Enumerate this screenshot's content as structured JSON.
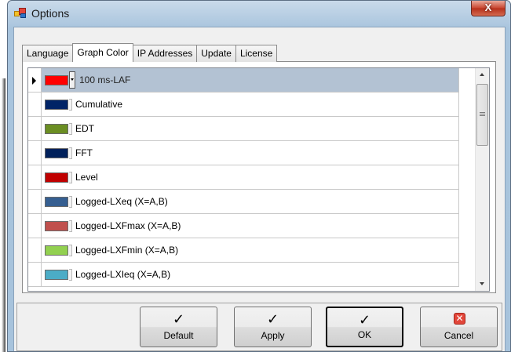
{
  "window": {
    "title": "Options",
    "close_glyph": "X"
  },
  "tabs": [
    {
      "label": "Language",
      "active": false
    },
    {
      "label": "Graph Color",
      "active": true
    },
    {
      "label": "IP Addresses",
      "active": false
    },
    {
      "label": "Update",
      "active": false
    },
    {
      "label": "License",
      "active": false
    }
  ],
  "grid": {
    "rows": [
      {
        "label": "100 ms-LAF",
        "color": "#ff0000",
        "selected": true
      },
      {
        "label": "Cumulative",
        "color": "#002366",
        "selected": false
      },
      {
        "label": "EDT",
        "color": "#6b8e23",
        "selected": false
      },
      {
        "label": "FFT",
        "color": "#00205b",
        "selected": false
      },
      {
        "label": "Level",
        "color": "#c00000",
        "selected": false
      },
      {
        "label": "Logged-LXeq (X=A,B)",
        "color": "#365f91",
        "selected": false
      },
      {
        "label": "Logged-LXFmax (X=A,B)",
        "color": "#c0504d",
        "selected": false
      },
      {
        "label": "Logged-LXFmin (X=A,B)",
        "color": "#92d050",
        "selected": false
      },
      {
        "label": "Logged-LXIeq (X=A,B)",
        "color": "#4bacc6",
        "selected": false
      }
    ]
  },
  "buttons": {
    "default": {
      "label": "Default",
      "glyph": "✓"
    },
    "apply": {
      "label": "Apply",
      "glyph": "✓"
    },
    "ok": {
      "label": "OK",
      "glyph": "✓"
    },
    "cancel": {
      "label": "Cancel",
      "glyph": "✕"
    }
  }
}
